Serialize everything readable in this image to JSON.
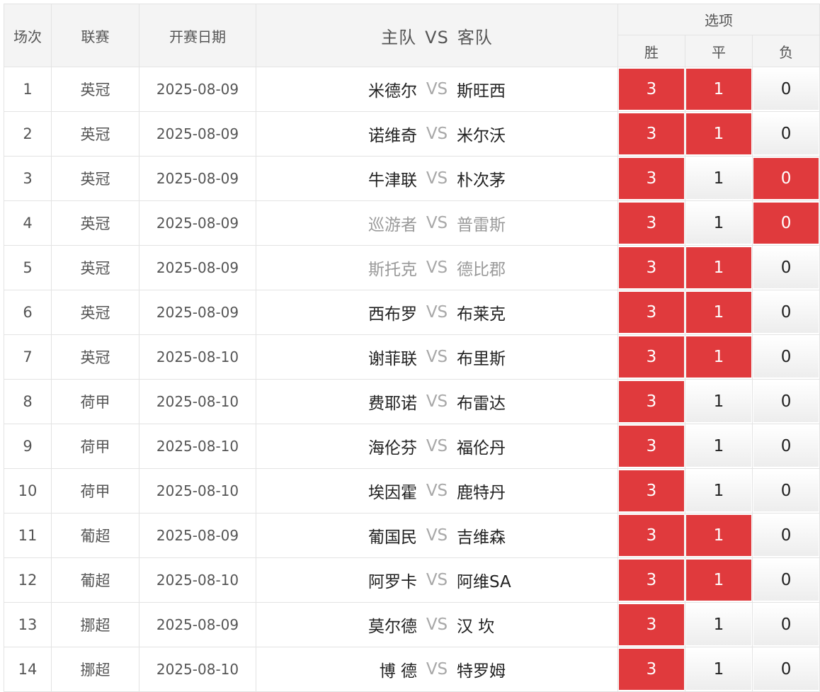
{
  "header": {
    "col_index": "场次",
    "col_league": "联赛",
    "col_date": "开赛日期",
    "col_match_home": "主队",
    "col_match_vs": "VS",
    "col_match_away": "客队",
    "col_options": "选项",
    "opt_win": "胜",
    "opt_draw": "平",
    "opt_lose": "负"
  },
  "colors": {
    "selected": "#e03a3d",
    "vs_text": "#a8a8a8"
  },
  "rows": [
    {
      "index": "1",
      "league": "英冠",
      "date": "2025-08-09",
      "home": "米德尔",
      "vs": "VS",
      "away": "斯旺西",
      "dim": false,
      "win": "3",
      "draw": "1",
      "lose": "0",
      "sel": [
        true,
        true,
        false
      ]
    },
    {
      "index": "2",
      "league": "英冠",
      "date": "2025-08-09",
      "home": "诺维奇",
      "vs": "VS",
      "away": "米尔沃",
      "dim": false,
      "win": "3",
      "draw": "1",
      "lose": "0",
      "sel": [
        true,
        true,
        false
      ]
    },
    {
      "index": "3",
      "league": "英冠",
      "date": "2025-08-09",
      "home": "牛津联",
      "vs": "VS",
      "away": "朴次茅",
      "dim": false,
      "win": "3",
      "draw": "1",
      "lose": "0",
      "sel": [
        true,
        false,
        true
      ]
    },
    {
      "index": "4",
      "league": "英冠",
      "date": "2025-08-09",
      "home": "巡游者",
      "vs": "VS",
      "away": "普雷斯",
      "dim": true,
      "win": "3",
      "draw": "1",
      "lose": "0",
      "sel": [
        true,
        false,
        true
      ]
    },
    {
      "index": "5",
      "league": "英冠",
      "date": "2025-08-09",
      "home": "斯托克",
      "vs": "VS",
      "away": "德比郡",
      "dim": true,
      "win": "3",
      "draw": "1",
      "lose": "0",
      "sel": [
        true,
        true,
        false
      ]
    },
    {
      "index": "6",
      "league": "英冠",
      "date": "2025-08-09",
      "home": "西布罗",
      "vs": "VS",
      "away": "布莱克",
      "dim": false,
      "win": "3",
      "draw": "1",
      "lose": "0",
      "sel": [
        true,
        true,
        false
      ]
    },
    {
      "index": "7",
      "league": "英冠",
      "date": "2025-08-10",
      "home": "谢菲联",
      "vs": "VS",
      "away": "布里斯",
      "dim": false,
      "win": "3",
      "draw": "1",
      "lose": "0",
      "sel": [
        true,
        true,
        false
      ]
    },
    {
      "index": "8",
      "league": "荷甲",
      "date": "2025-08-10",
      "home": "费耶诺",
      "vs": "VS",
      "away": "布雷达",
      "dim": false,
      "win": "3",
      "draw": "1",
      "lose": "0",
      "sel": [
        true,
        false,
        false
      ]
    },
    {
      "index": "9",
      "league": "荷甲",
      "date": "2025-08-10",
      "home": "海伦芬",
      "vs": "VS",
      "away": "福伦丹",
      "dim": false,
      "win": "3",
      "draw": "1",
      "lose": "0",
      "sel": [
        true,
        false,
        false
      ]
    },
    {
      "index": "10",
      "league": "荷甲",
      "date": "2025-08-10",
      "home": "埃因霍",
      "vs": "VS",
      "away": "鹿特丹",
      "dim": false,
      "win": "3",
      "draw": "1",
      "lose": "0",
      "sel": [
        true,
        false,
        false
      ]
    },
    {
      "index": "11",
      "league": "葡超",
      "date": "2025-08-09",
      "home": "葡国民",
      "vs": "VS",
      "away": "吉维森",
      "dim": false,
      "win": "3",
      "draw": "1",
      "lose": "0",
      "sel": [
        true,
        true,
        false
      ]
    },
    {
      "index": "12",
      "league": "葡超",
      "date": "2025-08-10",
      "home": "阿罗卡",
      "vs": "VS",
      "away": "阿维SA",
      "dim": false,
      "win": "3",
      "draw": "1",
      "lose": "0",
      "sel": [
        true,
        true,
        false
      ]
    },
    {
      "index": "13",
      "league": "挪超",
      "date": "2025-08-09",
      "home": "莫尔德",
      "vs": "VS",
      "away": "汉 坎",
      "dim": false,
      "win": "3",
      "draw": "1",
      "lose": "0",
      "sel": [
        true,
        false,
        false
      ]
    },
    {
      "index": "14",
      "league": "挪超",
      "date": "2025-08-10",
      "home": "博 德",
      "vs": "VS",
      "away": "特罗姆",
      "dim": false,
      "win": "3",
      "draw": "1",
      "lose": "0",
      "sel": [
        true,
        false,
        false
      ]
    }
  ]
}
